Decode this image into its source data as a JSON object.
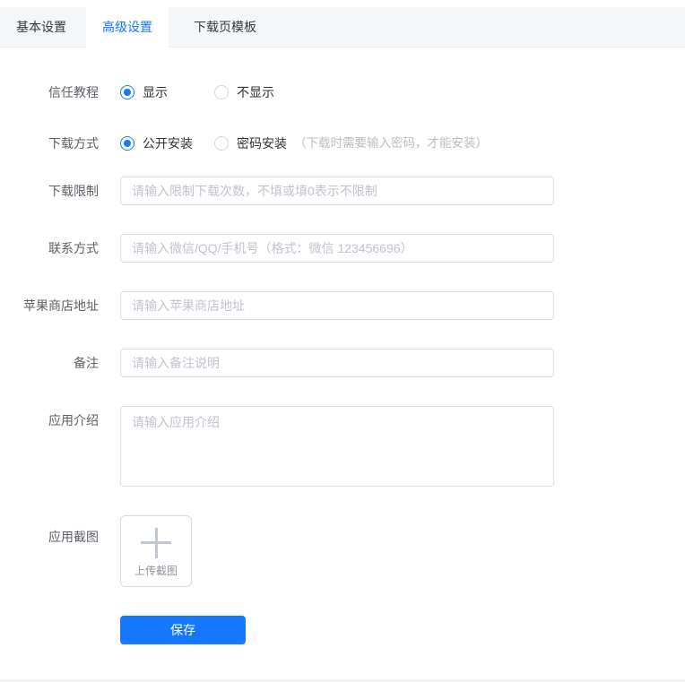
{
  "tabs": [
    {
      "label": "基本设置",
      "active": false
    },
    {
      "label": "高级设置",
      "active": true
    },
    {
      "label": "下载页模板",
      "active": false
    }
  ],
  "form": {
    "trust_tutorial": {
      "label": "信任教程",
      "options": [
        {
          "label": "显示",
          "selected": true
        },
        {
          "label": "不显示",
          "selected": false
        }
      ]
    },
    "download_method": {
      "label": "下载方式",
      "options": [
        {
          "label": "公开安装",
          "selected": true
        },
        {
          "label": "密码安装",
          "selected": false
        }
      ],
      "note": "（下载时需要输入密码，才能安装）"
    },
    "download_limit": {
      "label": "下载限制",
      "placeholder": "请输入限制下载次数，不填或填0表示不限制",
      "value": ""
    },
    "contact": {
      "label": "联系方式",
      "placeholder": "请输入微信/QQ/手机号（格式：微信 123456696）",
      "value": ""
    },
    "app_store_url": {
      "label": "苹果商店地址",
      "placeholder": "请输入苹果商店地址",
      "value": ""
    },
    "remark": {
      "label": "备注",
      "placeholder": "请输入备注说明",
      "value": ""
    },
    "app_intro": {
      "label": "应用介绍",
      "placeholder": "请输入应用介绍",
      "value": ""
    },
    "app_screenshot": {
      "label": "应用截图",
      "upload_text": "上传截图"
    },
    "save_label": "保存"
  },
  "colors": {
    "accent_blue": "#1677ff",
    "tab_bar_bg": "#f5f6f8",
    "border": "#dcdfe6",
    "placeholder": "#bfc3cc",
    "note_text": "#b9bdc4"
  }
}
